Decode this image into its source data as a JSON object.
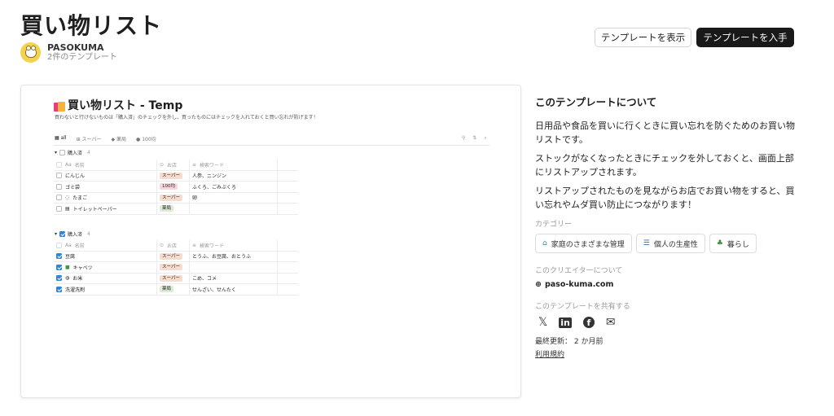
{
  "page": {
    "title": "買い物リスト",
    "author_name": "PASOKUMA",
    "author_count": "2件のテンプレート",
    "view_button": "テンプレートを表示",
    "get_button": "テンプレートを入手"
  },
  "preview": {
    "title": "買い物リスト - Temp",
    "description": "買わないと行けないものは「購入済」のチェックを外し、買ったものにはチェックを入れておくと買い忘れが防げます！",
    "tabs": [
      "all",
      "スーパー",
      "薬局",
      "100均"
    ],
    "groups": [
      {
        "label": "購入済",
        "count": "4",
        "checked": false,
        "headers": [
          "名前",
          "お店",
          "検索ワード"
        ],
        "rows": [
          {
            "checked": false,
            "name": "にんじん",
            "store": "スーパー",
            "store_color": "#f6dccf",
            "keywords": "人参、ニンジン"
          },
          {
            "checked": false,
            "name": "ゴミ袋",
            "store": "100均",
            "store_color": "#f8d6dd",
            "keywords": "ふくろ、ごみぶくろ"
          },
          {
            "checked": false,
            "name": "たまご",
            "store": "スーパー",
            "store_color": "#f6dccf",
            "keywords": "卵"
          },
          {
            "checked": false,
            "name": "トイレットペーパー",
            "store": "薬局",
            "store_color": "#dcecd9",
            "keywords": ""
          }
        ]
      },
      {
        "label": "購入済",
        "count": "4",
        "checked": true,
        "headers": [
          "名前",
          "お店",
          "検索ワード"
        ],
        "rows": [
          {
            "checked": true,
            "name": "豆腐",
            "store": "スーパー",
            "store_color": "#f6dccf",
            "keywords": "とうふ、お豆腐、おとうふ"
          },
          {
            "checked": true,
            "name": "キャベツ",
            "store": "スーパー",
            "store_color": "#f6dccf",
            "keywords": ""
          },
          {
            "checked": true,
            "name": "お米",
            "store": "スーパー",
            "store_color": "#f6dccf",
            "keywords": "こめ、コメ"
          },
          {
            "checked": true,
            "name": "洗濯洗剤",
            "store": "薬局",
            "store_color": "#dcecd9",
            "keywords": "せんざい、せんたく"
          }
        ]
      }
    ]
  },
  "about": {
    "heading": "このテンプレートについて",
    "paragraphs": [
      "日用品や食品を買いに行くときに買い忘れを防ぐためのお買い物リストです。",
      "ストックがなくなったときにチェックを外しておくと、画面上部にリストアップされます。",
      "リストアップされたものを見ながらお店でお買い物をすると、買い忘れやムダ買い防止につながります！"
    ],
    "category_label": "カテゴリー",
    "categories": [
      {
        "label": "家庭のさまざまな管理",
        "icon": "home-icon"
      },
      {
        "label": "個人の生産性",
        "icon": "checklist-icon"
      },
      {
        "label": "暮らし",
        "icon": "plant-icon"
      }
    ],
    "creator_label": "このクリエイターについて",
    "creator_site": "paso-kuma.com",
    "share_label": "このテンプレートを共有する",
    "share_icons": [
      "x-icon",
      "linkedin-icon",
      "facebook-icon",
      "mail-icon"
    ],
    "updated": "最終更新： 2 か月前",
    "terms": "利用規約"
  }
}
